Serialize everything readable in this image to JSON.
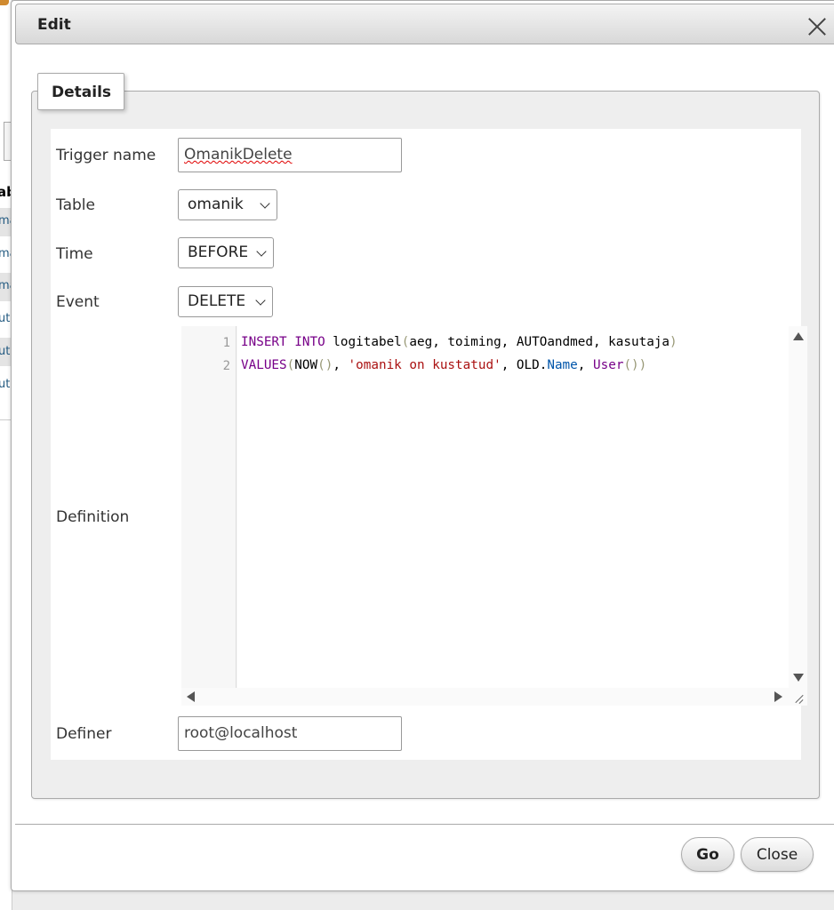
{
  "dialog": {
    "title": "Edit",
    "close_icon": "close-icon",
    "legend": "Details"
  },
  "form": {
    "trigger_name": {
      "label": "Trigger name",
      "value": "OmanikDelete"
    },
    "table": {
      "label": "Table",
      "value": "omanik"
    },
    "time": {
      "label": "Time",
      "value": "BEFORE"
    },
    "event": {
      "label": "Event",
      "value": "DELETE"
    },
    "definition": {
      "label": "Definition",
      "line_numbers": [
        "1",
        "2"
      ],
      "lines": [
        [
          {
            "t": "INSERT",
            "c": "kw"
          },
          {
            "t": " "
          },
          {
            "t": "INTO",
            "c": "kw"
          },
          {
            "t": " logitabel"
          },
          {
            "t": "(",
            "c": "br"
          },
          {
            "t": "aeg, toiming, AUTOandmed, kasutaja"
          },
          {
            "t": ")",
            "c": "br"
          }
        ],
        [
          {
            "t": "VALUES",
            "c": "kw"
          },
          {
            "t": "(",
            "c": "br"
          },
          {
            "t": "NOW"
          },
          {
            "t": "()",
            "c": "br"
          },
          {
            "t": ", "
          },
          {
            "t": "'omanik on kustatud'",
            "c": "str"
          },
          {
            "t": ", OLD."
          },
          {
            "t": "Name",
            "c": "prop"
          },
          {
            "t": ", "
          },
          {
            "t": "User",
            "c": "kw"
          },
          {
            "t": "())",
            "c": "br"
          }
        ]
      ]
    },
    "definer": {
      "label": "Definer",
      "value": "root@localhost"
    }
  },
  "buttons": {
    "go": "Go",
    "close": "Close"
  },
  "background": {
    "heading": "ab",
    "links": [
      "ma",
      "ma",
      "ma",
      "ute",
      "ute",
      "ute"
    ]
  },
  "colors": {
    "keyword": "#770088",
    "string": "#aa1111",
    "property": "#0055aa",
    "link": "#235a81"
  }
}
